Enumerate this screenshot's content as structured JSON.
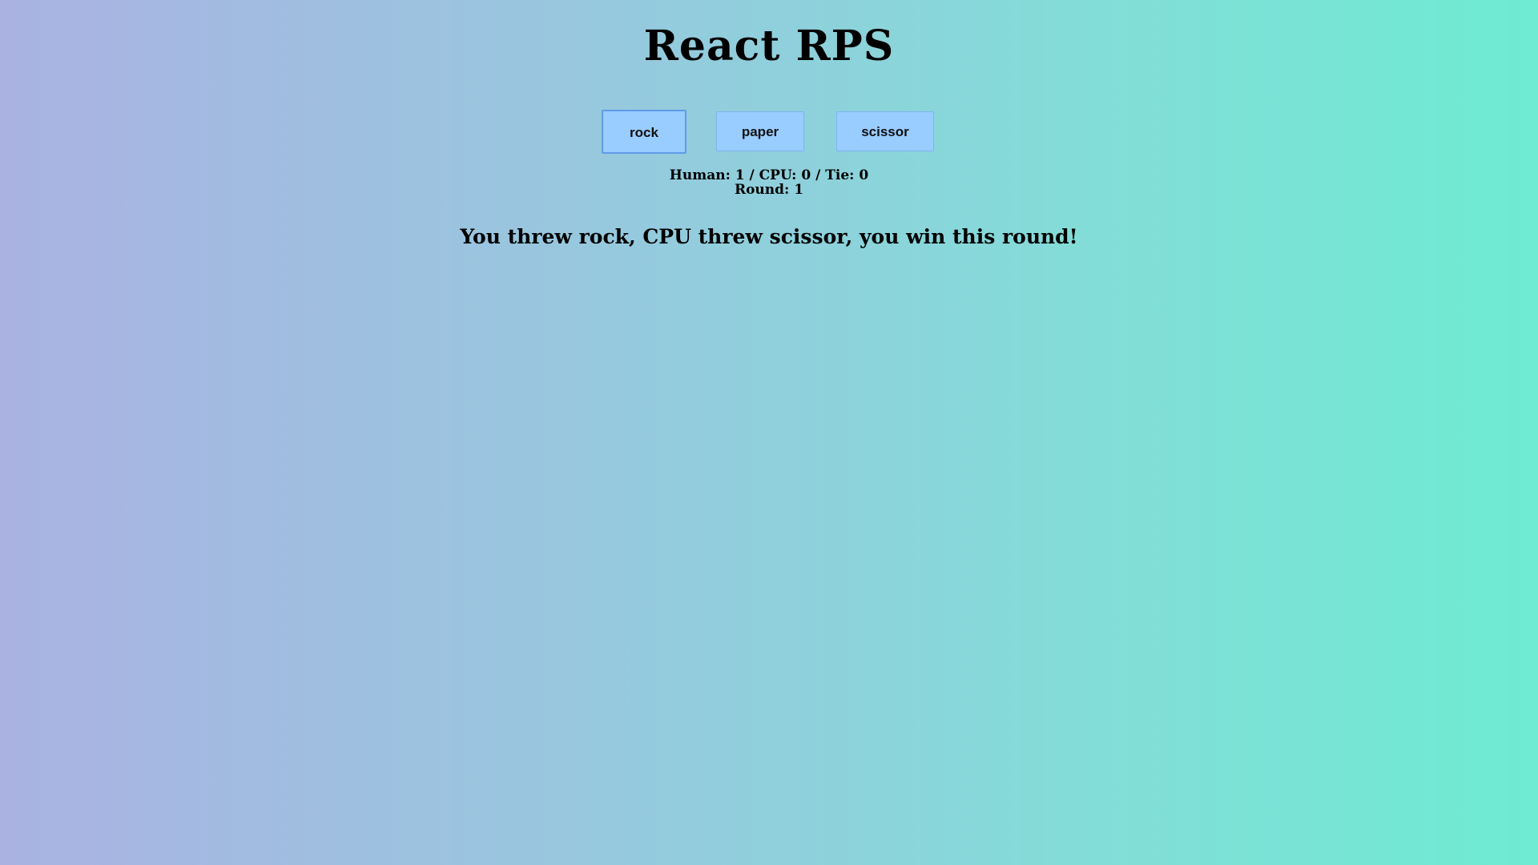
{
  "app": {
    "title": "React RPS"
  },
  "choices": {
    "rock": "rock",
    "paper": "paper",
    "scissor": "scissor"
  },
  "score": {
    "line": "Human: 1 / CPU: 0 / Tie: 0",
    "round": "Round: 1"
  },
  "result": {
    "message": "You threw rock, CPU threw scissor, you win this round!"
  },
  "colors": {
    "background_left": "#aab2e2",
    "background_right": "#6eebd2",
    "button_fill": "#99ccff",
    "button_border": "#7fb3f0"
  }
}
